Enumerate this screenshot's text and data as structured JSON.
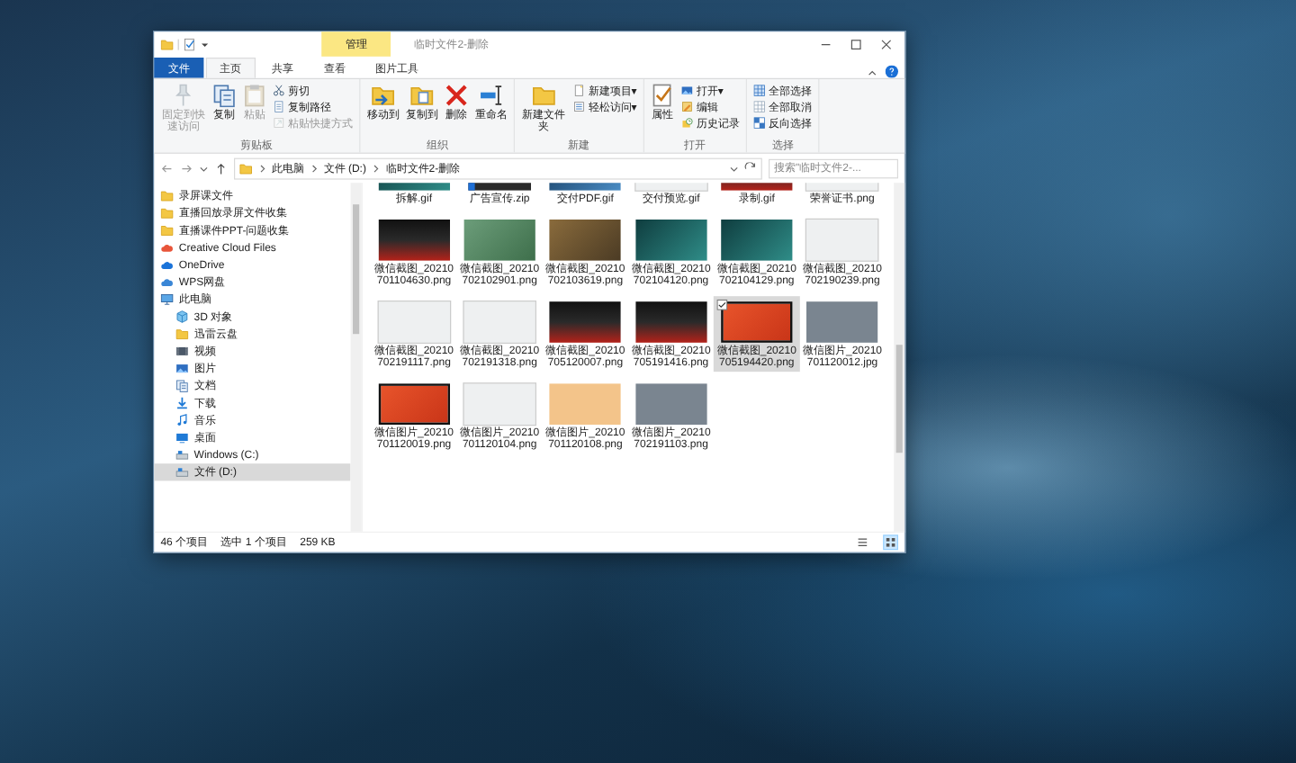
{
  "window": {
    "title": "临时文件2-删除",
    "context_tab": "管理"
  },
  "tabs": [
    {
      "label": "文件",
      "kind": "file",
      "selected": false
    },
    {
      "label": "主页",
      "kind": "tab",
      "selected": true
    },
    {
      "label": "共享",
      "kind": "tab",
      "selected": false
    },
    {
      "label": "查看",
      "kind": "tab",
      "selected": false
    },
    {
      "label": "图片工具",
      "kind": "tab",
      "selected": false
    }
  ],
  "ribbon_groups": [
    {
      "label": "剪贴板",
      "items": [
        {
          "label": "固定到快速访问",
          "kind": "large",
          "disabled": true
        },
        {
          "label": "复制",
          "kind": "large",
          "disabled": false
        },
        {
          "label": "粘贴",
          "kind": "large",
          "disabled": true
        },
        {
          "label": "剪切",
          "kind": "small",
          "disabled": false
        },
        {
          "label": "复制路径",
          "kind": "small",
          "disabled": false
        },
        {
          "label": "粘贴快捷方式",
          "kind": "small",
          "disabled": true
        }
      ]
    },
    {
      "label": "组织",
      "items": [
        {
          "label": "移动到",
          "kind": "large",
          "disabled": false
        },
        {
          "label": "复制到",
          "kind": "large",
          "disabled": false
        },
        {
          "label": "删除",
          "kind": "large",
          "disabled": false
        },
        {
          "label": "重命名",
          "kind": "large",
          "disabled": false
        }
      ]
    },
    {
      "label": "新建",
      "items": [
        {
          "label": "新建文件夹",
          "kind": "large",
          "disabled": false
        },
        {
          "label": "新建项目▾",
          "kind": "small",
          "disabled": false
        },
        {
          "label": "轻松访问▾",
          "kind": "small",
          "disabled": false
        }
      ]
    },
    {
      "label": "打开",
      "items": [
        {
          "label": "属性",
          "kind": "large",
          "disabled": false
        },
        {
          "label": "打开▾",
          "kind": "small",
          "disabled": false
        },
        {
          "label": "编辑",
          "kind": "small",
          "disabled": false
        },
        {
          "label": "历史记录",
          "kind": "small",
          "disabled": false
        }
      ]
    },
    {
      "label": "选择",
      "items": [
        {
          "label": "全部选择",
          "kind": "small",
          "disabled": false
        },
        {
          "label": "全部取消",
          "kind": "small",
          "disabled": false
        },
        {
          "label": "反向选择",
          "kind": "small",
          "disabled": false
        }
      ]
    }
  ],
  "address": {
    "parts": [
      "此电脑",
      "文件 (D:)",
      "临时文件2-删除"
    ]
  },
  "search": {
    "placeholder": "搜索\"临时文件2-..."
  },
  "sidebar": {
    "items": [
      {
        "label": "录屏课文件",
        "kind": "folder",
        "selected": false
      },
      {
        "label": "直播回放录屏文件收集",
        "kind": "folder",
        "selected": false
      },
      {
        "label": "直播课件PPT-问题收集",
        "kind": "folder",
        "selected": false
      },
      {
        "label": "Creative Cloud Files",
        "kind": "cc",
        "selected": false
      },
      {
        "label": "OneDrive",
        "kind": "onedrive",
        "selected": false
      },
      {
        "label": "WPS网盘",
        "kind": "wps",
        "selected": false
      },
      {
        "label": "此电脑",
        "kind": "pc",
        "selected": false,
        "children": [
          {
            "label": "3D 对象",
            "kind": "cube",
            "selected": false
          },
          {
            "label": "迅雷云盘",
            "kind": "folder",
            "selected": false
          },
          {
            "label": "视频",
            "kind": "video",
            "selected": false
          },
          {
            "label": "图片",
            "kind": "picture",
            "selected": false
          },
          {
            "label": "文档",
            "kind": "doc",
            "selected": false
          },
          {
            "label": "下载",
            "kind": "download",
            "selected": false
          },
          {
            "label": "音乐",
            "kind": "music",
            "selected": false
          },
          {
            "label": "桌面",
            "kind": "desktop",
            "selected": false
          },
          {
            "label": "Windows (C:)",
            "kind": "drive",
            "selected": false
          },
          {
            "label": "文件 (D:)",
            "kind": "drive",
            "selected": true
          }
        ]
      }
    ]
  },
  "files": [
    {
      "name": "拆解.gif",
      "kind": "teal",
      "selected": false
    },
    {
      "name": "广告宣传.zip",
      "kind": "zip",
      "selected": false
    },
    {
      "name": "交付PDF.gif",
      "kind": "blue",
      "selected": false
    },
    {
      "name": "交付预览.gif",
      "kind": "light",
      "selected": false
    },
    {
      "name": "录制.gif",
      "kind": "dark",
      "selected": false
    },
    {
      "name": "荣誉证书.png",
      "kind": "light",
      "selected": false
    },
    {
      "name": "微信截图_20210701104630.png",
      "kind": "dark",
      "selected": false
    },
    {
      "name": "微信截图_20210702102901.png",
      "kind": "green",
      "selected": false
    },
    {
      "name": "微信截图_20210702103619.png",
      "kind": "brown",
      "selected": false
    },
    {
      "name": "微信截图_20210702104120.png",
      "kind": "teal",
      "selected": false
    },
    {
      "name": "微信截图_20210702104129.png",
      "kind": "teal",
      "selected": false
    },
    {
      "name": "微信截图_20210702190239.png",
      "kind": "light",
      "selected": false
    },
    {
      "name": "微信截图_20210702191117.png",
      "kind": "light",
      "selected": false
    },
    {
      "name": "微信截图_20210702191318.png",
      "kind": "light",
      "selected": false
    },
    {
      "name": "微信截图_20210705120007.png",
      "kind": "dark",
      "selected": false
    },
    {
      "name": "微信截图_20210705191416.png",
      "kind": "dark",
      "selected": false
    },
    {
      "name": "微信截图_20210705194420.png",
      "kind": "orange",
      "selected": true
    },
    {
      "name": "微信图片_20210701120012.jpg",
      "kind": "photo",
      "selected": false
    },
    {
      "name": "微信图片_20210701120019.png",
      "kind": "orange",
      "selected": false
    },
    {
      "name": "微信图片_20210701120104.png",
      "kind": "light",
      "selected": false
    },
    {
      "name": "微信图片_20210701120108.png",
      "kind": "peach",
      "selected": false
    },
    {
      "name": "微信图片_20210702191103.png",
      "kind": "photo",
      "selected": false
    }
  ],
  "status_bar": {
    "count": "46 个项目",
    "selection": "选中 1 个项目",
    "size": "259 KB"
  },
  "view_buttons": [
    {
      "kind": "details",
      "selected": false
    },
    {
      "kind": "large",
      "selected": true
    }
  ]
}
